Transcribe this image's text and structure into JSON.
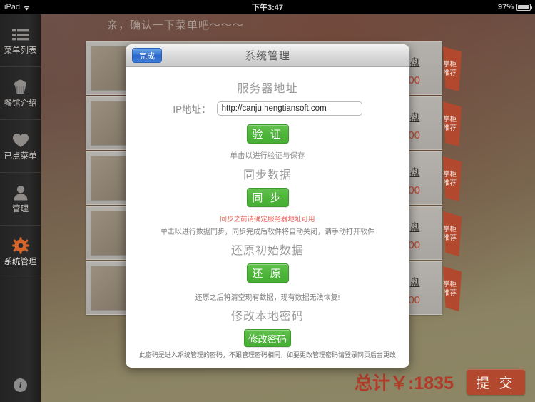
{
  "statusbar": {
    "device": "iPad",
    "wifi_icon": "wifi-icon",
    "time": "下午3:47",
    "battery_percent": "97%",
    "battery_icon": "battery-icon"
  },
  "sidebar": {
    "items": [
      {
        "label": "菜单列表",
        "icon": "list-icon",
        "active": false
      },
      {
        "label": "餐馆介绍",
        "icon": "cupcake-icon",
        "active": false
      },
      {
        "label": "已点菜单",
        "icon": "heart-icon",
        "active": false
      },
      {
        "label": "管理",
        "icon": "user-icon",
        "active": false
      },
      {
        "label": "系统管理",
        "icon": "gear-icon",
        "active": true
      }
    ],
    "info_icon_label": "i",
    "active_icon_color": "#d4652c"
  },
  "content": {
    "header_text": "亲，确认一下菜单吧～～～",
    "dish_rows": [
      {
        "unit": "/盘",
        "price": "00",
        "ribbon": "掌柜推荐"
      },
      {
        "unit": "/盘",
        "price": "00",
        "ribbon": "掌柜推荐"
      },
      {
        "unit": "/盘",
        "price": "00",
        "ribbon": "掌柜推荐"
      },
      {
        "unit": "/盘",
        "price": "00",
        "ribbon": "掌柜推荐"
      },
      {
        "unit": "/盘",
        "price": "00",
        "ribbon": "掌柜推荐"
      }
    ],
    "total_text": "总计￥:1835",
    "submit_label": "提 交",
    "accent_red": "#b2492f"
  },
  "modal": {
    "title": "系统管理",
    "done_label": "完成",
    "server": {
      "section_title": "服务器地址",
      "ip_label": "IP地址：",
      "ip_value": "http://canju.hengtiansoft.com",
      "ip_placeholder": "http://",
      "verify_label": "验 证",
      "verify_hint": "单击以进行验证与保存"
    },
    "sync": {
      "section_title": "同步数据",
      "sync_label": "同 步",
      "warning": "同步之前请确定服务器地址可用",
      "hint": "单击以进行数据同步，同步完成后软件将自动关闭，请手动打开软件",
      "warning_color": "#e8605a"
    },
    "restore": {
      "section_title": "还原初始数据",
      "restore_label": "还 原",
      "hint": "还原之后将清空现有数据，现有数据无法恢复!"
    },
    "password": {
      "section_title": "修改本地密码",
      "change_label": "修改密码",
      "footnote": "此密码是进入系统管理的密码，不跟管理密码相同，如要更改管理密码请登录网页后台更改"
    },
    "green_accent": "#4fb53c"
  }
}
